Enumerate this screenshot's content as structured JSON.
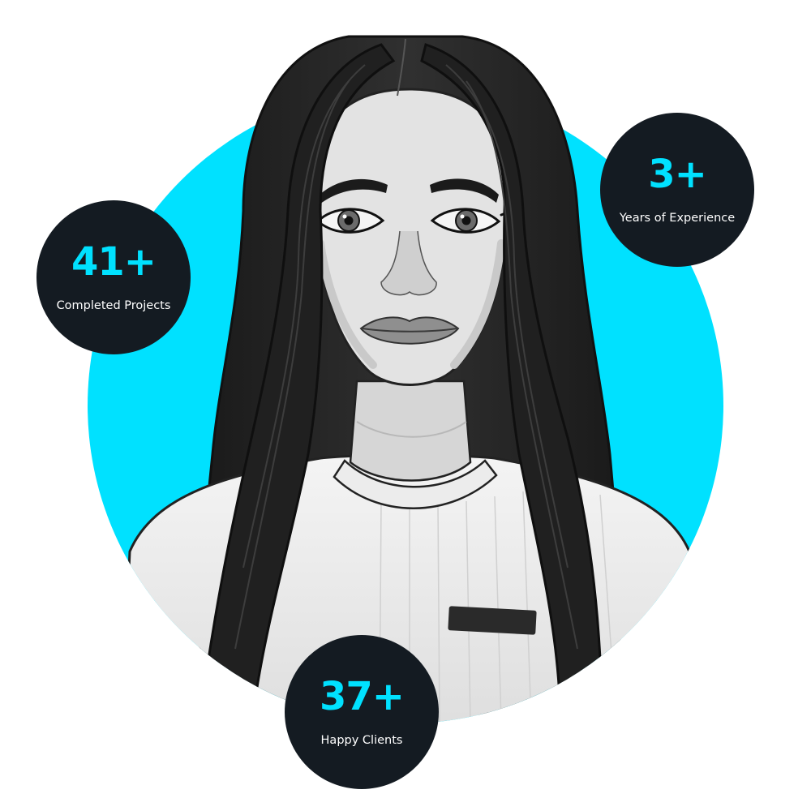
{
  "colors": {
    "accent": "#00e1ff",
    "badge_background": "#141b22",
    "badge_label": "#ffffff",
    "background": "#ffffff"
  },
  "portrait": {
    "subject": "grayscale-illustrated-woman-portrait"
  },
  "stats": {
    "projects": {
      "value": "41+",
      "label": "Completed Projects"
    },
    "years": {
      "value": "3+",
      "label": "Years of Experience"
    },
    "clients": {
      "value": "37+",
      "label": "Happy Clients"
    }
  }
}
